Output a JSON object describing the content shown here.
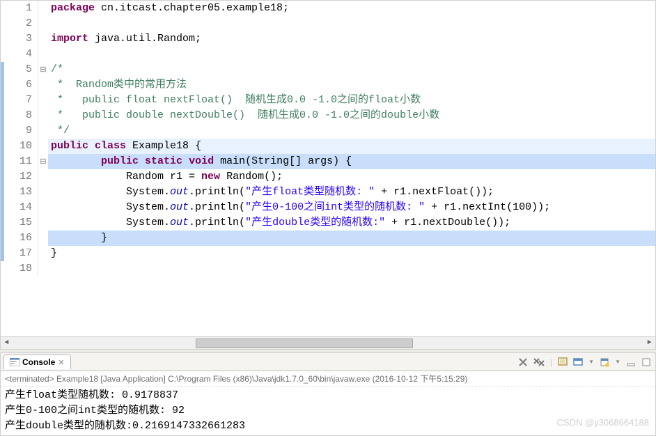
{
  "editor": {
    "lines": [
      {
        "n": "1",
        "fold": "",
        "hl": "",
        "tokens": [
          {
            "cls": "kw",
            "t": "package"
          },
          {
            "cls": "",
            "t": " cn.itcast.chapter05.example18;"
          }
        ]
      },
      {
        "n": "2",
        "fold": "",
        "hl": "",
        "tokens": [
          {
            "cls": "",
            "t": ""
          }
        ]
      },
      {
        "n": "3",
        "fold": "",
        "hl": "",
        "tokens": [
          {
            "cls": "kw",
            "t": "import"
          },
          {
            "cls": "",
            "t": " java.util.Random;"
          }
        ]
      },
      {
        "n": "4",
        "fold": "",
        "hl": "",
        "tokens": [
          {
            "cls": "",
            "t": ""
          }
        ]
      },
      {
        "n": "5",
        "fold": "minus",
        "hl": "",
        "strip": true,
        "tokens": [
          {
            "cls": "cm",
            "t": "/*"
          }
        ]
      },
      {
        "n": "6",
        "fold": "",
        "hl": "",
        "strip": true,
        "tokens": [
          {
            "cls": "cm",
            "t": " *  Random类中的常用方法"
          }
        ]
      },
      {
        "n": "7",
        "fold": "",
        "hl": "",
        "strip": true,
        "tokens": [
          {
            "cls": "cm",
            "t": " *   public float nextFloat()  随机生成0.0 -1.0之间的float小数"
          }
        ]
      },
      {
        "n": "8",
        "fold": "",
        "hl": "",
        "strip": true,
        "tokens": [
          {
            "cls": "cm",
            "t": " *   public double nextDouble()  随机生成0.0 -1.0之间的double小数"
          }
        ]
      },
      {
        "n": "9",
        "fold": "",
        "hl": "",
        "strip": true,
        "tokens": [
          {
            "cls": "cm",
            "t": " */"
          }
        ]
      },
      {
        "n": "10",
        "fold": "",
        "hl": "hl-cur",
        "strip": true,
        "tokens": [
          {
            "cls": "kw",
            "t": "public"
          },
          {
            "cls": "",
            "t": " "
          },
          {
            "cls": "kw",
            "t": "class"
          },
          {
            "cls": "",
            "t": " Example18 {"
          }
        ]
      },
      {
        "n": "11",
        "fold": "minus",
        "hl": "hl-blue",
        "strip": true,
        "tokens": [
          {
            "cls": "",
            "t": "        "
          },
          {
            "cls": "kw",
            "t": "public"
          },
          {
            "cls": "",
            "t": " "
          },
          {
            "cls": "kw",
            "t": "static"
          },
          {
            "cls": "",
            "t": " "
          },
          {
            "cls": "kw",
            "t": "void"
          },
          {
            "cls": "",
            "t": " main(String[] args) {"
          }
        ]
      },
      {
        "n": "12",
        "fold": "",
        "hl": "",
        "strip": true,
        "tokens": [
          {
            "cls": "",
            "t": "            Random r1 = "
          },
          {
            "cls": "kw",
            "t": "new"
          },
          {
            "cls": "",
            "t": " Random();"
          }
        ]
      },
      {
        "n": "13",
        "fold": "",
        "hl": "",
        "strip": true,
        "tokens": [
          {
            "cls": "",
            "t": "            System."
          },
          {
            "cls": "field",
            "t": "out"
          },
          {
            "cls": "",
            "t": ".println("
          },
          {
            "cls": "str",
            "t": "\"产生float类型随机数: \""
          },
          {
            "cls": "",
            "t": " + r1.nextFloat());"
          }
        ]
      },
      {
        "n": "14",
        "fold": "",
        "hl": "",
        "strip": true,
        "tokens": [
          {
            "cls": "",
            "t": "            System."
          },
          {
            "cls": "field",
            "t": "out"
          },
          {
            "cls": "",
            "t": ".println("
          },
          {
            "cls": "str",
            "t": "\"产生0-100之间int类型的随机数: \""
          },
          {
            "cls": "",
            "t": " + r1.nextInt(100));"
          }
        ]
      },
      {
        "n": "15",
        "fold": "",
        "hl": "",
        "strip": true,
        "tokens": [
          {
            "cls": "",
            "t": "            System."
          },
          {
            "cls": "field",
            "t": "out"
          },
          {
            "cls": "",
            "t": ".println("
          },
          {
            "cls": "str",
            "t": "\"产生double类型的随机数:\""
          },
          {
            "cls": "",
            "t": " + r1.nextDouble());"
          }
        ]
      },
      {
        "n": "16",
        "fold": "",
        "hl": "hl-blue",
        "strip": true,
        "tokens": [
          {
            "cls": "",
            "t": "        }"
          }
        ]
      },
      {
        "n": "17",
        "fold": "",
        "hl": "",
        "strip": true,
        "tokens": [
          {
            "cls": "",
            "t": "}"
          }
        ]
      },
      {
        "n": "18",
        "fold": "",
        "hl": "",
        "tokens": [
          {
            "cls": "",
            "t": ""
          }
        ]
      }
    ]
  },
  "console": {
    "tab_label": "Console",
    "header": "<terminated> Example18 [Java Application] C:\\Program Files (x86)\\Java\\jdk1.7.0_60\\bin\\javaw.exe (2016-10-12 下午5:15:29)",
    "lines": [
      "产生float类型随机数: 0.9178837",
      "产生0-100之间int类型的随机数: 92",
      "产生double类型的随机数:0.2169147332661283"
    ]
  },
  "watermark": "CSDN @y3068664188"
}
